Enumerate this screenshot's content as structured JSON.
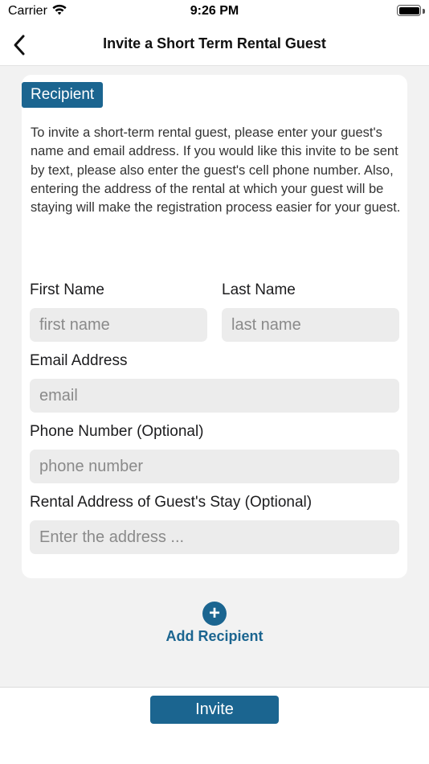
{
  "status_bar": {
    "carrier": "Carrier",
    "time": "9:26 PM"
  },
  "nav": {
    "title": "Invite a Short Term Rental Guest",
    "back_icon": "chevron-left-icon"
  },
  "recipient": {
    "badge": "Recipient",
    "intro": "To invite a short-term rental guest, please enter your guest's name and email address. If you would like this invite to be sent by text, please also enter the guest's cell phone number. Also, entering the address of the rental at which your guest will be staying will make the registration process easier for your guest.",
    "first_name": {
      "label": "First Name",
      "placeholder": "first name",
      "value": ""
    },
    "last_name": {
      "label": "Last Name",
      "placeholder": "last name",
      "value": ""
    },
    "email": {
      "label": "Email Address",
      "placeholder": "email",
      "value": ""
    },
    "phone": {
      "label": "Phone Number (Optional)",
      "placeholder": "phone number",
      "value": ""
    },
    "address": {
      "label": "Rental Address of Guest's Stay (Optional)",
      "placeholder": "Enter the address ...",
      "value": ""
    }
  },
  "add_recipient": {
    "icon": "+",
    "label": "Add Recipient"
  },
  "actions": {
    "invite_label": "Invite"
  },
  "colors": {
    "accent": "#1b6590",
    "background": "#f2f2f2",
    "field": "#ececec"
  }
}
